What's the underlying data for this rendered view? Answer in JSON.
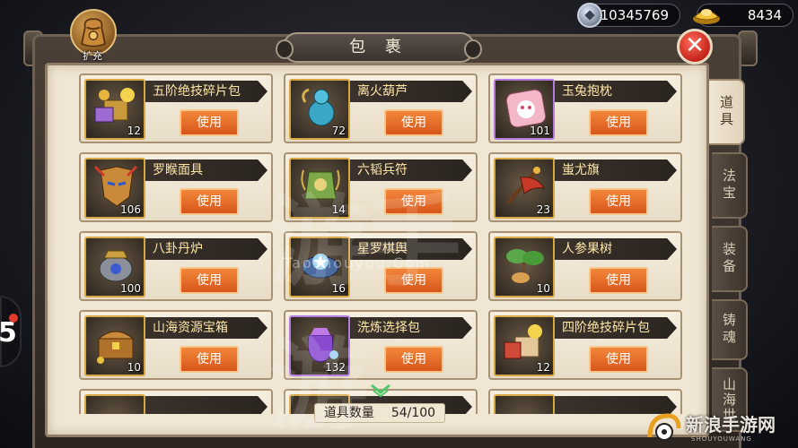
{
  "currency": {
    "silver": "10345769",
    "gold": "8434"
  },
  "window": {
    "title": "包 裹",
    "expand_label": "扩充",
    "close_symbol": "✕"
  },
  "items": [
    {
      "name": "五阶绝技碎片包",
      "count": "12",
      "button": "使用"
    },
    {
      "name": "离火葫芦",
      "count": "72",
      "button": "使用"
    },
    {
      "name": "玉兔抱枕",
      "count": "101",
      "button": "使用"
    },
    {
      "name": "罗睺面具",
      "count": "106",
      "button": "使用"
    },
    {
      "name": "六韬兵符",
      "count": "14",
      "button": "使用"
    },
    {
      "name": "蚩尤旗",
      "count": "23",
      "button": "使用"
    },
    {
      "name": "八卦丹炉",
      "count": "100",
      "button": "使用"
    },
    {
      "name": "星罗棋舆",
      "count": "16",
      "button": "使用"
    },
    {
      "name": "人参果树",
      "count": "10",
      "button": "使用"
    },
    {
      "name": "山海资源宝箱",
      "count": "10",
      "button": "使用"
    },
    {
      "name": "洗炼选择包",
      "count": "132",
      "button": "使用"
    },
    {
      "name": "四阶绝技碎片包",
      "count": "12",
      "button": "使用"
    }
  ],
  "tabs": [
    {
      "label": "道具",
      "active": true
    },
    {
      "label": "法宝",
      "active": false
    },
    {
      "label": "装备",
      "active": false
    },
    {
      "label": "铸魂",
      "active": false
    },
    {
      "label": "山海世",
      "active": false
    }
  ],
  "footer": {
    "count_label": "道具数量",
    "count_value": "54/100"
  },
  "overlay": {
    "watermark": "游手游",
    "watermark_url": "Taoshouyou.Com",
    "site_logo": "新浪手游网",
    "site_logo_en": "SHOUYOUWANG",
    "side_number": "5"
  },
  "colors": {
    "button_orange": "#e26a27",
    "name_text": "#ffe7a8",
    "panel_cream": "#efe6d4",
    "close_red": "#c4231a"
  }
}
